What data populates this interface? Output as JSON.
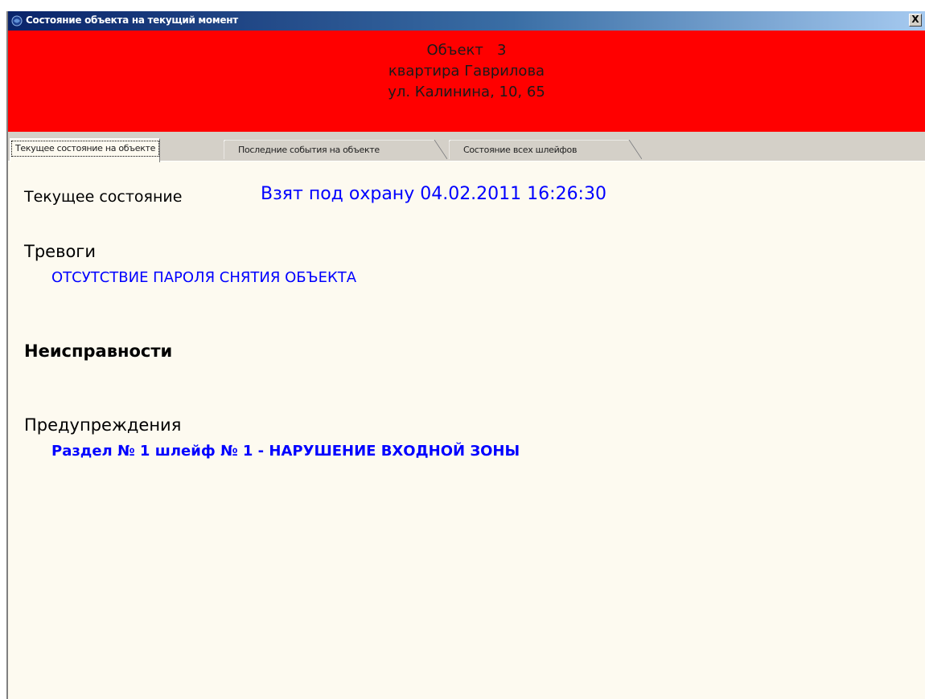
{
  "window": {
    "title": "Состояние объекта на текущий момент",
    "close_label": "X"
  },
  "header": {
    "line1": "Объект   3",
    "line2": "квартира Гаврилова",
    "line3": "ул. Калинина, 10, 65",
    "background": "#ff0000"
  },
  "tabs": [
    {
      "label": "Текущее состояние на объекте",
      "active": true
    },
    {
      "label": "Последние события на объекте",
      "active": false
    },
    {
      "label": "Состояние всех шлейфов",
      "active": false
    }
  ],
  "content": {
    "current_state_label": "Текущее состояние",
    "current_state_value": "Взят под охрану 04.02.2011 16:26:30",
    "alarms_heading": "Тревоги",
    "alarms": [
      "ОТСУТСТВИЕ ПАРОЛЯ СНЯТИЯ ОБЪЕКТА"
    ],
    "faults_heading": "Неисправности",
    "warnings_heading": "Предупреждения",
    "warnings": [
      "Раздел № 1 шлейф № 1 - НАРУШЕНИЕ ВХОДНОЙ ЗОНЫ"
    ]
  },
  "colors": {
    "value_blue": "#0000ff",
    "panel_bg": "#fdfaf0",
    "titlebar_start": "#0a246a"
  }
}
